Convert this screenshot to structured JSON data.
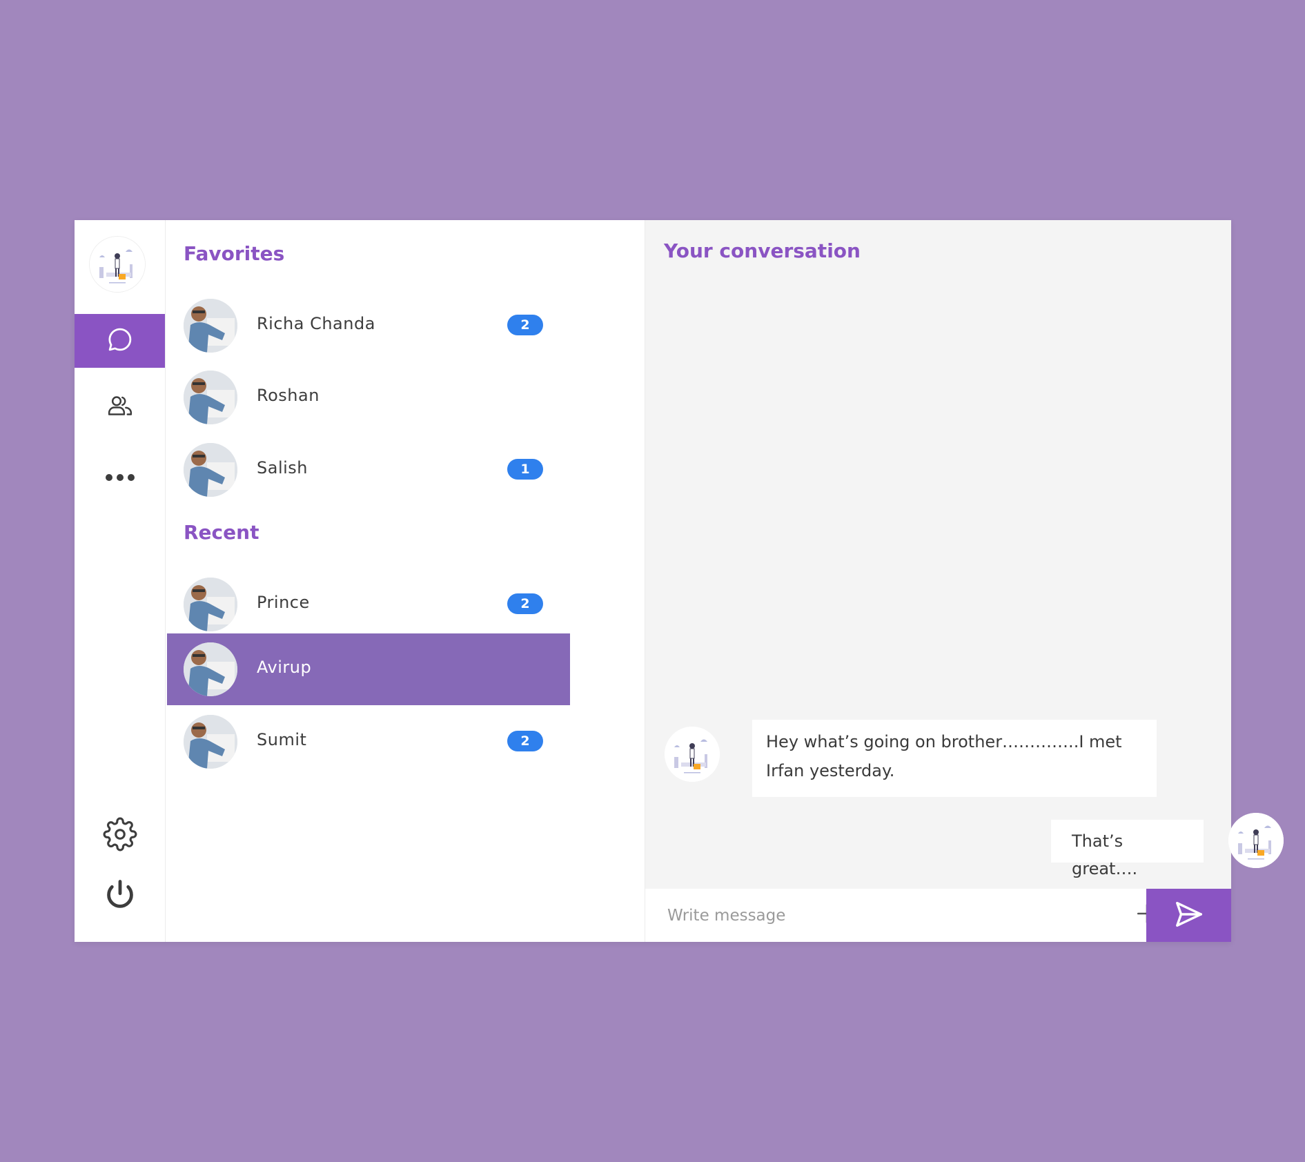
{
  "lists": {
    "favorites_title": "Favorites",
    "recent_title": "Recent",
    "favorites": [
      {
        "name": "Richa Chanda",
        "badge": "2"
      },
      {
        "name": "Roshan",
        "badge": ""
      },
      {
        "name": "Salish",
        "badge": "1"
      }
    ],
    "recent": [
      {
        "name": "Prince",
        "badge": "2"
      },
      {
        "name": "Avirup",
        "badge": ""
      },
      {
        "name": "Sumit",
        "badge": "2"
      }
    ]
  },
  "conversation": {
    "title": "Your conversation",
    "messages": [
      {
        "from": "other",
        "text": "Hey what’s going on brother…………..I met Irfan yesterday."
      },
      {
        "from": "me",
        "text": "That’s great…."
      }
    ],
    "composer_placeholder": "Write message"
  },
  "icons": {
    "rail": [
      "chat-icon",
      "contacts-icon",
      "more-icon",
      "settings-icon",
      "power-icon"
    ],
    "composer": [
      "plus-icon",
      "emoji-icon",
      "send-icon"
    ]
  },
  "colors": {
    "accent": "#8a54c3",
    "selected_row": "#8669b7",
    "badge": "#2f80ed",
    "page_background": "#a187bd"
  }
}
